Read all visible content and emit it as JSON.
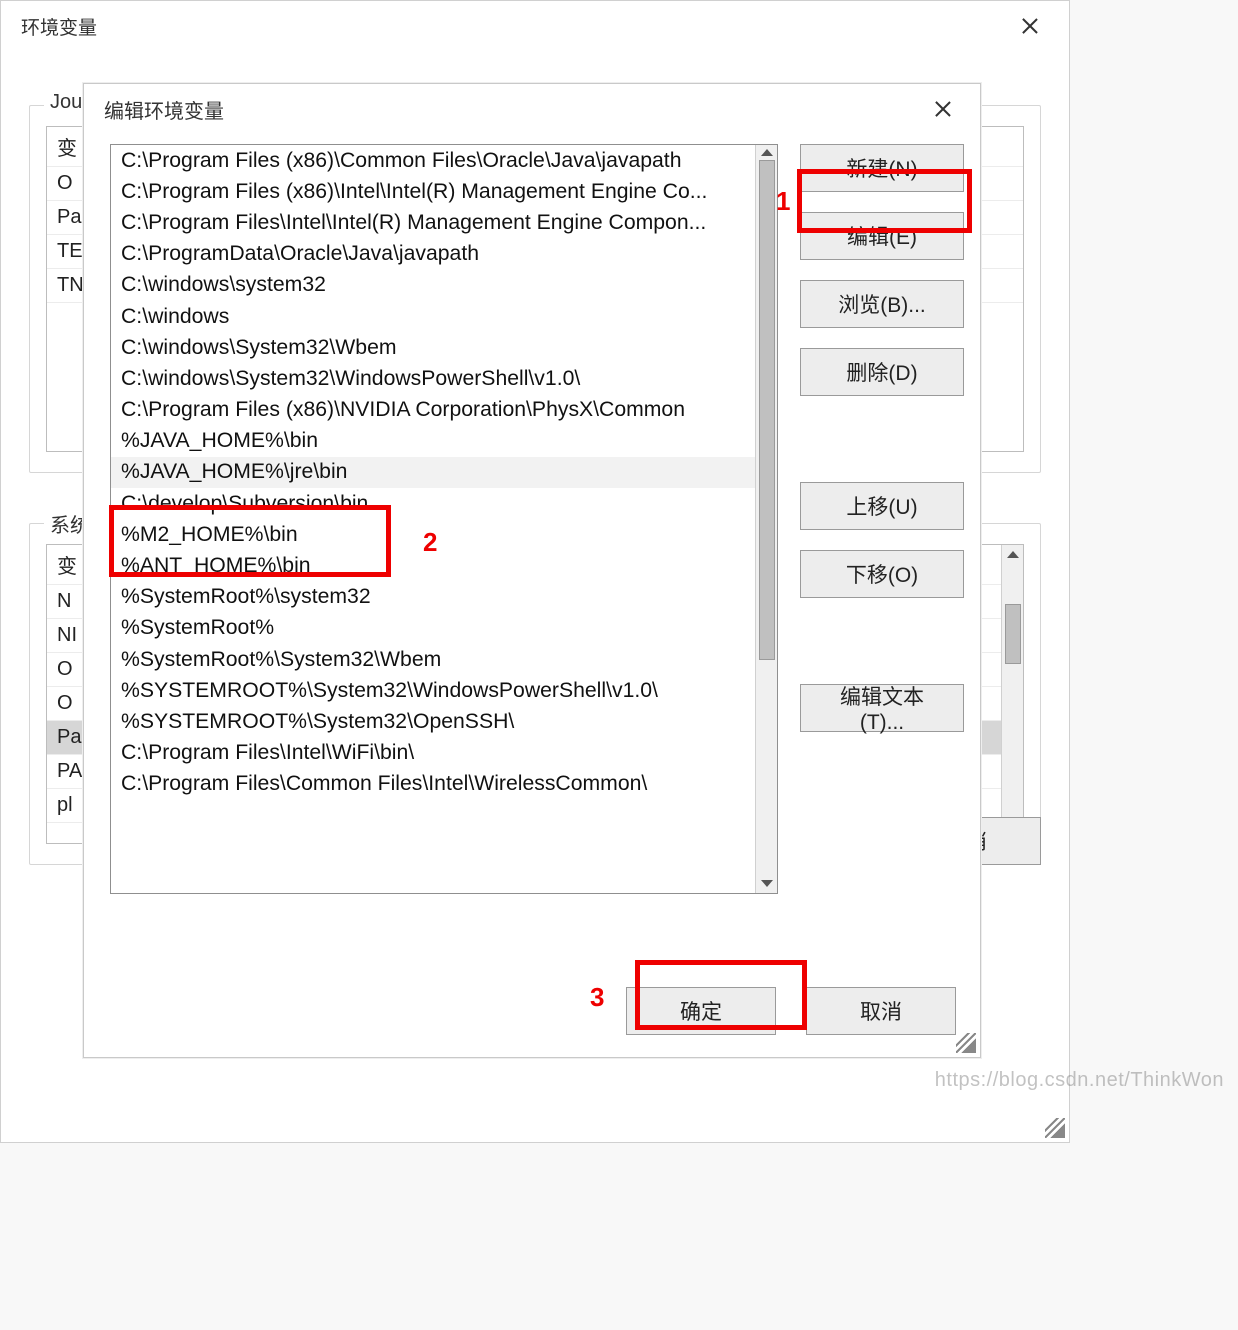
{
  "back": {
    "title": "环境变量",
    "user_group_legend": "Jour",
    "user_vars_header": "变",
    "user_vars_partial": [
      "O",
      "Pa",
      "TE",
      "TN"
    ],
    "sys_group_legend": "系统",
    "sys_vars_header": "变",
    "sys_vars_partial": [
      "N",
      "NI",
      "O",
      "O",
      "Pa",
      "PA",
      "pl"
    ],
    "sys_vars_selected_index": 4,
    "ok_label": "确定",
    "cancel_label": "取消"
  },
  "front": {
    "title": "编辑环境变量",
    "paths": [
      "C:\\Program Files (x86)\\Common Files\\Oracle\\Java\\javapath",
      "C:\\Program Files (x86)\\Intel\\Intel(R) Management Engine Co...",
      "C:\\Program Files\\Intel\\Intel(R) Management Engine Compon...",
      "C:\\ProgramData\\Oracle\\Java\\javapath",
      "C:\\windows\\system32",
      "C:\\windows",
      "C:\\windows\\System32\\Wbem",
      "C:\\windows\\System32\\WindowsPowerShell\\v1.0\\",
      "C:\\Program Files (x86)\\NVIDIA Corporation\\PhysX\\Common",
      "%JAVA_HOME%\\bin",
      "%JAVA_HOME%\\jre\\bin",
      "C:\\develop\\Subversion\\bin",
      "%M2_HOME%\\bin",
      "%ANT_HOME%\\bin",
      "%SystemRoot%\\system32",
      "%SystemRoot%",
      "%SystemRoot%\\System32\\Wbem",
      "%SYSTEMROOT%\\System32\\WindowsPowerShell\\v1.0\\",
      "%SYSTEMROOT%\\System32\\OpenSSH\\",
      "C:\\Program Files\\Intel\\WiFi\\bin\\",
      "C:\\Program Files\\Common Files\\Intel\\WirelessCommon\\"
    ],
    "zebra_index": 10,
    "buttons": {
      "new": "新建(N)",
      "edit": "编辑(E)",
      "browse": "浏览(B)...",
      "delete": "删除(D)",
      "move_up": "上移(U)",
      "move_down": "下移(O)",
      "edit_text": "编辑文本(T)..."
    },
    "ok_label": "确定",
    "cancel_label": "取消"
  },
  "annotations": {
    "label1": "1",
    "label2": "2",
    "label3": "3"
  },
  "watermark": "https://blog.csdn.net/ThinkWon"
}
